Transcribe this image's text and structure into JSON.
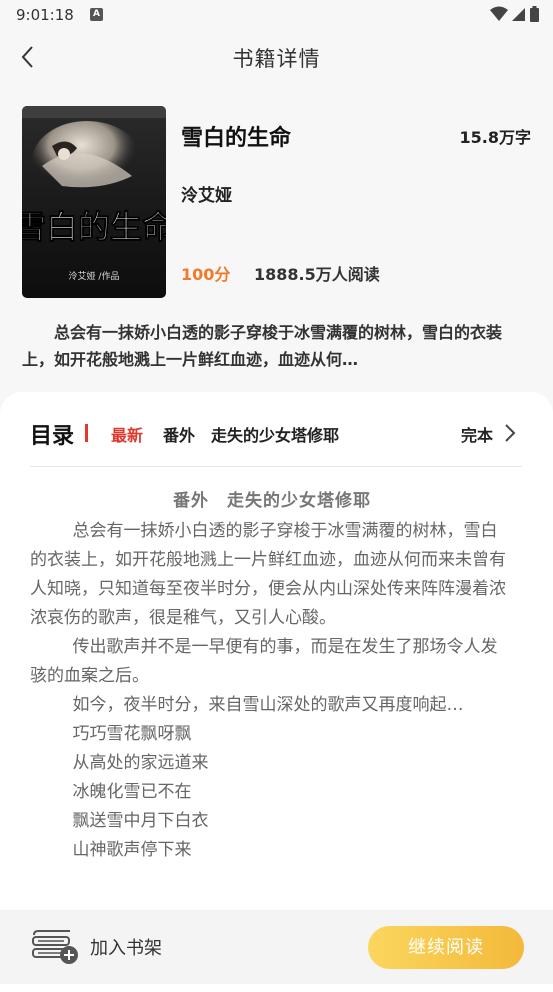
{
  "status_bar": {
    "time": "9:01:18",
    "notif_letter": "A"
  },
  "header": {
    "title": "书籍详情"
  },
  "book": {
    "title": "雪白的生命",
    "word_count": "15.8万字",
    "author": "泠艾娅",
    "score": "100分",
    "readers": "1888.5万人阅读",
    "cover_title": "雪白的生命",
    "cover_author": "泠艾娅 /作品",
    "summary": "总会有一抹娇小白透的影子穿梭于冰雪满覆的树林，雪白的衣装上，如开花般地溅上一片鲜红血迹，血迹从何…"
  },
  "catalog": {
    "title": "目录",
    "latest_label": "最新",
    "latest_chapter": "番外　走失的少女塔修耶",
    "status": "完本"
  },
  "chapter_preview": {
    "heading": "番外　走失的少女塔修耶",
    "paragraphs": [
      "总会有一抹娇小白透的影子穿梭于冰雪满覆的树林，雪白的衣装上，如开花般地溅上一片鲜红血迹，血迹从何而来未曾有人知晓，只知道每至夜半时分，便会从内山深处传来阵阵漫着浓浓哀伤的歌声，很是稚气，又引人心酸。",
      "传出歌声并不是一早便有的事，而是在发生了那场令人发骇的血案之后。",
      "如今，夜半时分，来自雪山深处的歌声又再度响起…",
      "巧巧雪花飘呀飘",
      "从高处的家远道来",
      "冰魄化雪已不在",
      "飘送雪中月下白衣",
      "山神歌声停下来"
    ]
  },
  "bottom_bar": {
    "shelf_label": "加入书架",
    "continue_label": "继续阅读"
  },
  "colors": {
    "accent_red": "#e03a2f",
    "score_orange": "#f07a2a",
    "button_yellow": "#f5c445"
  }
}
